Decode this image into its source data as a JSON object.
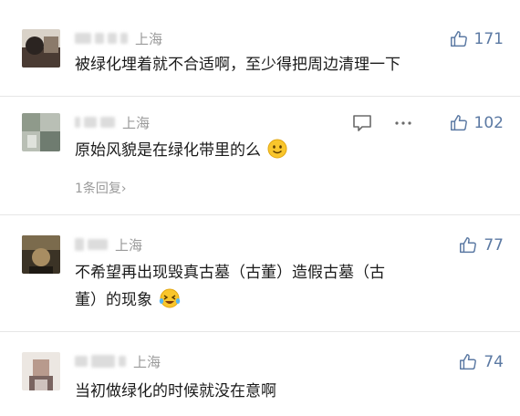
{
  "comments": [
    {
      "location": "上海",
      "likes": "171",
      "text": "被绿化埋着就不合适啊，至少得把周边清理一下"
    },
    {
      "location": "上海",
      "likes": "102",
      "text": "原始风貌是在绿化带里的么",
      "reply_link": "1条回复›"
    },
    {
      "location": "上海",
      "likes": "77",
      "text_line1": "不希望再出现毁真古墓（古董）造假古墓（古",
      "text_line2": "董）的现象"
    },
    {
      "location": "上海",
      "likes": "74",
      "text": "当初做绿化的时候就没在意啊"
    }
  ],
  "icons": {
    "like": "thumbs-up-icon",
    "comment": "comment-icon",
    "more": "more-icon",
    "smile": "smile-emoji",
    "laugh": "laughing-emoji"
  },
  "colors": {
    "accent": "#5b79a3",
    "muted": "#9a9a9a",
    "text": "#1b1b1b"
  }
}
